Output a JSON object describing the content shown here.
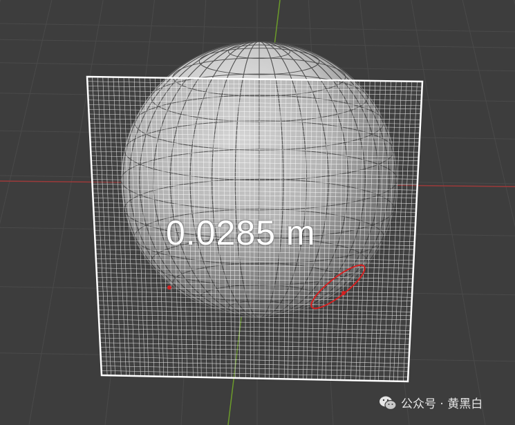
{
  "viewport": {
    "measurement_readout": "0.0285 m",
    "colors": {
      "background": "#3d3d3d",
      "grid": "#4a4a4a",
      "x_axis": "#9c3a3a",
      "y_axis": "#6c9c2a",
      "mesh_wire": "#ffffff",
      "selection": "#d42020"
    },
    "objects": [
      "uv-sphere",
      "subdivided-plane"
    ],
    "cursor_icon": "brush-circle-icon"
  },
  "watermark": {
    "icon": "wechat-icon",
    "text": "公众号 · 黄黑白"
  }
}
